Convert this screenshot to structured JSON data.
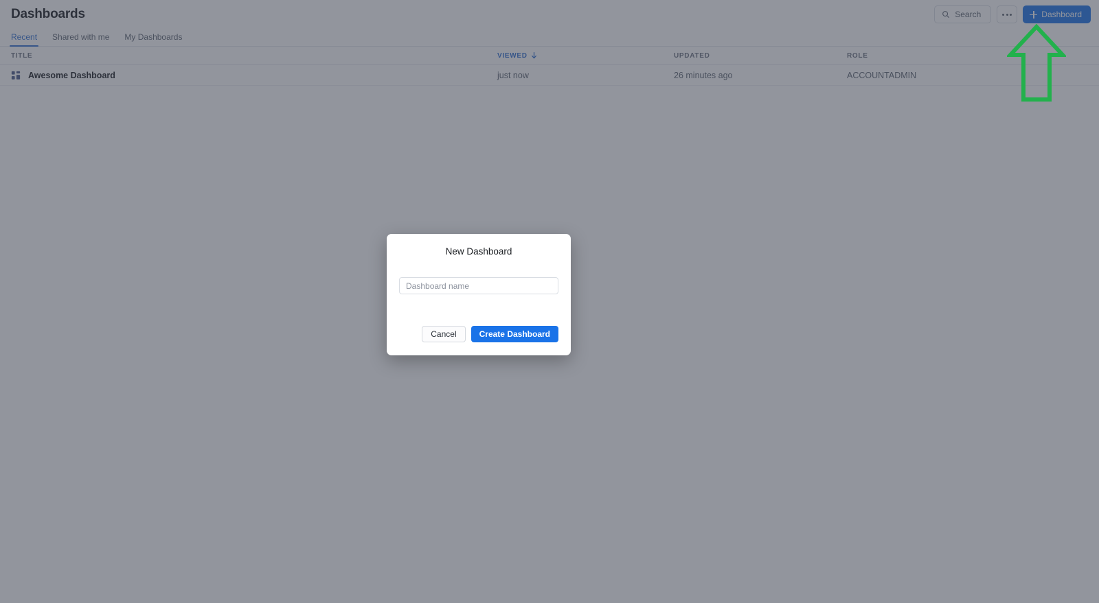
{
  "header": {
    "title": "Dashboards",
    "search": {
      "label": "Search",
      "icon": "search-icon"
    },
    "more": {
      "icon": "ellipsis-icon",
      "label": "More options"
    },
    "new_dashboard_button": {
      "label": "Dashboard",
      "icon": "plus-icon",
      "color": "#1a73e8"
    }
  },
  "tabs": [
    {
      "label": "Recent",
      "active": true
    },
    {
      "label": "Shared with me",
      "active": false
    },
    {
      "label": "My Dashboards",
      "active": false
    }
  ],
  "table": {
    "columns": [
      {
        "key": "title",
        "label": "TITLE",
        "sorted": false
      },
      {
        "key": "viewed",
        "label": "VIEWED",
        "sorted": true,
        "sort_direction": "desc"
      },
      {
        "key": "updated",
        "label": "UPDATED",
        "sorted": false
      },
      {
        "key": "role",
        "label": "ROLE",
        "sorted": false
      }
    ],
    "rows": [
      {
        "icon": "dashboard-grid-icon",
        "title": "Awesome Dashboard",
        "viewed": "just now",
        "updated": "26 minutes ago",
        "role": "ACCOUNTADMIN"
      }
    ]
  },
  "modal": {
    "title": "New Dashboard",
    "name_input": {
      "value": "",
      "placeholder": "Dashboard name"
    },
    "cancel_label": "Cancel",
    "create_label": "Create Dashboard"
  },
  "annotation": {
    "type": "up-arrow",
    "color": "#22b14c",
    "points_at": "Dashboard"
  },
  "colors": {
    "accent_blue": "#1a73e8",
    "tab_active": "#2f6fd0",
    "overlay": "#737885",
    "annotation_green": "#22b14c"
  }
}
